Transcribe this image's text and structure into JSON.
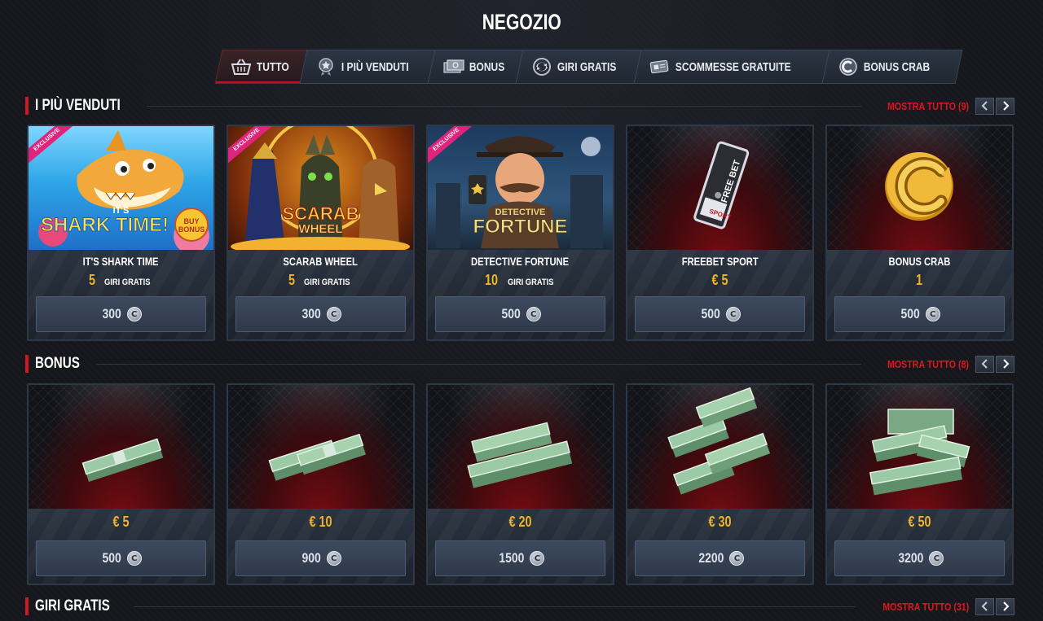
{
  "page": {
    "title": "NEGOZIO"
  },
  "tabs": [
    {
      "label": "TUTTO",
      "icon": "basket-icon",
      "active": true
    },
    {
      "label": "I PIÙ VENDUTI",
      "icon": "medal-icon",
      "active": false
    },
    {
      "label": "BONUS",
      "icon": "cash-icon",
      "active": false
    },
    {
      "label": "GIRI GRATIS",
      "icon": "spin-icon",
      "active": false
    },
    {
      "label": "SCOMMESSE GRATUITE",
      "icon": "ticket-icon",
      "active": false
    },
    {
      "label": "BONUS CRAB",
      "icon": "crab-coin-icon",
      "active": false
    }
  ],
  "sections": {
    "bestsellers": {
      "title": "I PIÙ VENDUTI",
      "show_all": "MOSTRA TUTTO (9)",
      "items": [
        {
          "name": "IT'S SHARK TIME",
          "reward_num": "5",
          "reward_unit": "GIRI GRATIS",
          "price": "300",
          "badge": "EXCLUSIVE",
          "art_text_1": "IT'S",
          "art_text_2": "SHARK TIME!",
          "art_text_3": "BUY BONUS"
        },
        {
          "name": "SCARAB WHEEL",
          "reward_num": "5",
          "reward_unit": "GIRI GRATIS",
          "price": "300",
          "badge": "EXCLUSIVE",
          "art_text_1": "SCARAB",
          "art_text_2": "WHEEL"
        },
        {
          "name": "DETECTIVE FORTUNE",
          "reward_num": "10",
          "reward_unit": "GIRI GRATIS",
          "price": "500",
          "badge": "EXCLUSIVE",
          "art_text_1": "DETECTIVE",
          "art_text_2": "FORTUNE"
        },
        {
          "name": "FREEBET SPORT",
          "reward_num": "€ 5",
          "reward_unit": "",
          "price": "500",
          "art_text_1": "FREE BET",
          "art_text_2": "SPORT"
        },
        {
          "name": "BONUS CRAB",
          "reward_num": "1",
          "reward_unit": "",
          "price": "500"
        }
      ]
    },
    "bonus": {
      "title": "BONUS",
      "show_all": "MOSTRA TUTTO (8)",
      "items": [
        {
          "amount": "€ 5",
          "price": "500"
        },
        {
          "amount": "€ 10",
          "price": "900"
        },
        {
          "amount": "€ 20",
          "price": "1500"
        },
        {
          "amount": "€ 30",
          "price": "2200"
        },
        {
          "amount": "€ 50",
          "price": "3200"
        }
      ]
    },
    "free_spins": {
      "title": "GIRI GRATIS",
      "show_all": "MOSTRA TUTTO (31)"
    }
  },
  "coin_symbol": "C",
  "colors": {
    "accent_red": "#d01822",
    "gold": "#f0b526",
    "exclusive_pink": "#e0247c"
  }
}
